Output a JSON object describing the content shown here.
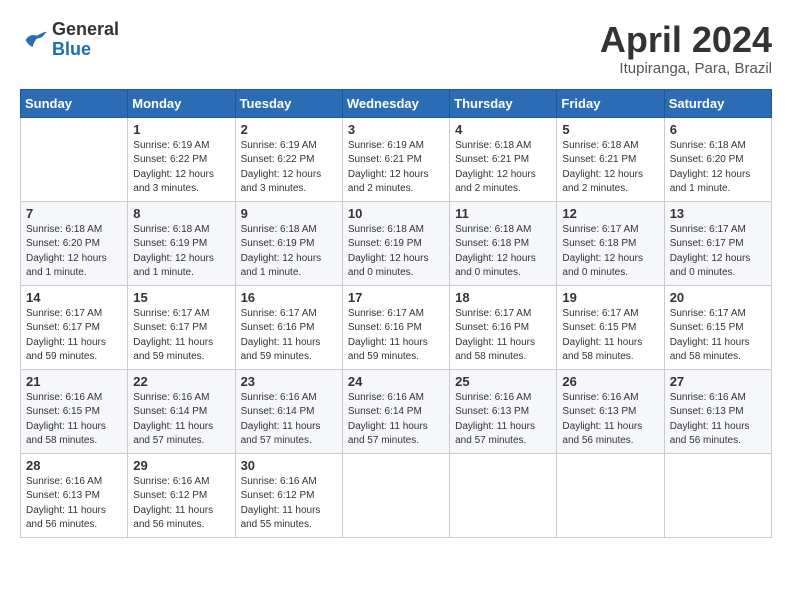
{
  "header": {
    "logo_general": "General",
    "logo_blue": "Blue",
    "month": "April 2024",
    "location": "Itupiranga, Para, Brazil"
  },
  "days_of_week": [
    "Sunday",
    "Monday",
    "Tuesday",
    "Wednesday",
    "Thursday",
    "Friday",
    "Saturday"
  ],
  "weeks": [
    [
      {
        "day": "",
        "info": ""
      },
      {
        "day": "1",
        "info": "Sunrise: 6:19 AM\nSunset: 6:22 PM\nDaylight: 12 hours\nand 3 minutes."
      },
      {
        "day": "2",
        "info": "Sunrise: 6:19 AM\nSunset: 6:22 PM\nDaylight: 12 hours\nand 3 minutes."
      },
      {
        "day": "3",
        "info": "Sunrise: 6:19 AM\nSunset: 6:21 PM\nDaylight: 12 hours\nand 2 minutes."
      },
      {
        "day": "4",
        "info": "Sunrise: 6:18 AM\nSunset: 6:21 PM\nDaylight: 12 hours\nand 2 minutes."
      },
      {
        "day": "5",
        "info": "Sunrise: 6:18 AM\nSunset: 6:21 PM\nDaylight: 12 hours\nand 2 minutes."
      },
      {
        "day": "6",
        "info": "Sunrise: 6:18 AM\nSunset: 6:20 PM\nDaylight: 12 hours\nand 1 minute."
      }
    ],
    [
      {
        "day": "7",
        "info": "Sunrise: 6:18 AM\nSunset: 6:20 PM\nDaylight: 12 hours\nand 1 minute."
      },
      {
        "day": "8",
        "info": "Sunrise: 6:18 AM\nSunset: 6:19 PM\nDaylight: 12 hours\nand 1 minute."
      },
      {
        "day": "9",
        "info": "Sunrise: 6:18 AM\nSunset: 6:19 PM\nDaylight: 12 hours\nand 1 minute."
      },
      {
        "day": "10",
        "info": "Sunrise: 6:18 AM\nSunset: 6:19 PM\nDaylight: 12 hours\nand 0 minutes."
      },
      {
        "day": "11",
        "info": "Sunrise: 6:18 AM\nSunset: 6:18 PM\nDaylight: 12 hours\nand 0 minutes."
      },
      {
        "day": "12",
        "info": "Sunrise: 6:17 AM\nSunset: 6:18 PM\nDaylight: 12 hours\nand 0 minutes."
      },
      {
        "day": "13",
        "info": "Sunrise: 6:17 AM\nSunset: 6:17 PM\nDaylight: 12 hours\nand 0 minutes."
      }
    ],
    [
      {
        "day": "14",
        "info": "Sunrise: 6:17 AM\nSunset: 6:17 PM\nDaylight: 11 hours\nand 59 minutes."
      },
      {
        "day": "15",
        "info": "Sunrise: 6:17 AM\nSunset: 6:17 PM\nDaylight: 11 hours\nand 59 minutes."
      },
      {
        "day": "16",
        "info": "Sunrise: 6:17 AM\nSunset: 6:16 PM\nDaylight: 11 hours\nand 59 minutes."
      },
      {
        "day": "17",
        "info": "Sunrise: 6:17 AM\nSunset: 6:16 PM\nDaylight: 11 hours\nand 59 minutes."
      },
      {
        "day": "18",
        "info": "Sunrise: 6:17 AM\nSunset: 6:16 PM\nDaylight: 11 hours\nand 58 minutes."
      },
      {
        "day": "19",
        "info": "Sunrise: 6:17 AM\nSunset: 6:15 PM\nDaylight: 11 hours\nand 58 minutes."
      },
      {
        "day": "20",
        "info": "Sunrise: 6:17 AM\nSunset: 6:15 PM\nDaylight: 11 hours\nand 58 minutes."
      }
    ],
    [
      {
        "day": "21",
        "info": "Sunrise: 6:16 AM\nSunset: 6:15 PM\nDaylight: 11 hours\nand 58 minutes."
      },
      {
        "day": "22",
        "info": "Sunrise: 6:16 AM\nSunset: 6:14 PM\nDaylight: 11 hours\nand 57 minutes."
      },
      {
        "day": "23",
        "info": "Sunrise: 6:16 AM\nSunset: 6:14 PM\nDaylight: 11 hours\nand 57 minutes."
      },
      {
        "day": "24",
        "info": "Sunrise: 6:16 AM\nSunset: 6:14 PM\nDaylight: 11 hours\nand 57 minutes."
      },
      {
        "day": "25",
        "info": "Sunrise: 6:16 AM\nSunset: 6:13 PM\nDaylight: 11 hours\nand 57 minutes."
      },
      {
        "day": "26",
        "info": "Sunrise: 6:16 AM\nSunset: 6:13 PM\nDaylight: 11 hours\nand 56 minutes."
      },
      {
        "day": "27",
        "info": "Sunrise: 6:16 AM\nSunset: 6:13 PM\nDaylight: 11 hours\nand 56 minutes."
      }
    ],
    [
      {
        "day": "28",
        "info": "Sunrise: 6:16 AM\nSunset: 6:13 PM\nDaylight: 11 hours\nand 56 minutes."
      },
      {
        "day": "29",
        "info": "Sunrise: 6:16 AM\nSunset: 6:12 PM\nDaylight: 11 hours\nand 56 minutes."
      },
      {
        "day": "30",
        "info": "Sunrise: 6:16 AM\nSunset: 6:12 PM\nDaylight: 11 hours\nand 55 minutes."
      },
      {
        "day": "",
        "info": ""
      },
      {
        "day": "",
        "info": ""
      },
      {
        "day": "",
        "info": ""
      },
      {
        "day": "",
        "info": ""
      }
    ]
  ]
}
